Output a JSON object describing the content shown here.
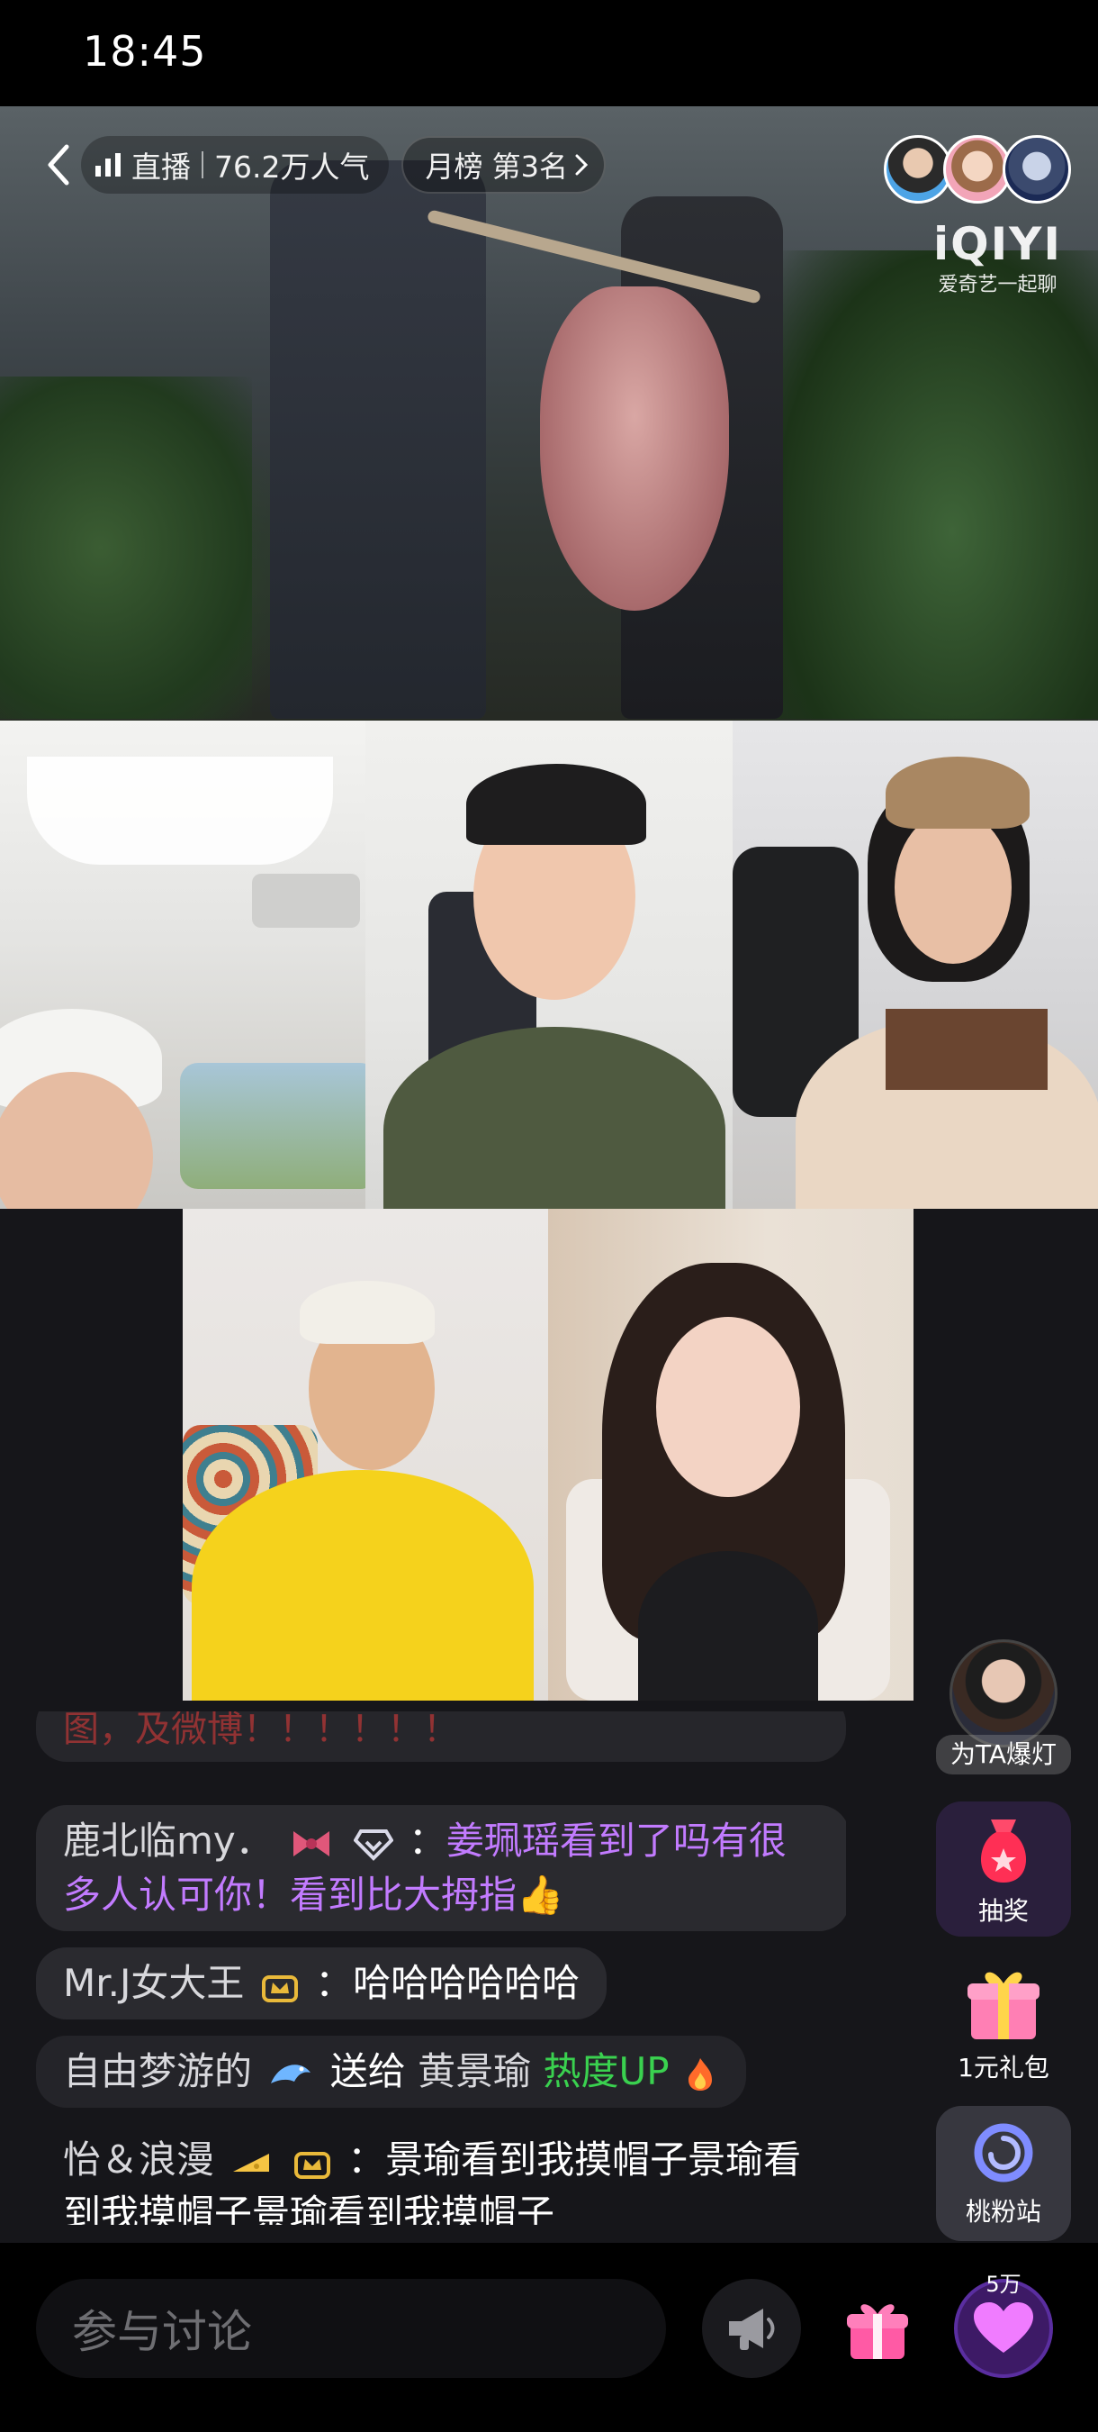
{
  "status_bar": {
    "time": "18:45"
  },
  "live_header": {
    "live_label": "直播",
    "popularity": "76.2万人气",
    "rank_label": "月榜 第3名",
    "brand_logo": "iQIYI",
    "brand_sub": "爱奇艺一起聊"
  },
  "chat": {
    "messages": [
      {
        "user": "",
        "text": "图，及微博！！！！！！"
      },
      {
        "user": "鹿北临my．",
        "text": "姜珮瑶看到了吗有很多人认可你！看到比大拇指👍"
      },
      {
        "user": "Mr.J女大王",
        "text": "哈哈哈哈哈哈"
      },
      {
        "user": "自由梦游的",
        "gift_to_label": "送给",
        "recipient": "黄景瑜",
        "gift_name": "热度UP"
      },
      {
        "user": "怡＆浪漫",
        "text": "景瑜看到我摸帽子景瑜看到我摸帽子景瑜看到我摸帽子"
      }
    ]
  },
  "side_actions": {
    "spotlight_label": "为TA爆灯",
    "lottery_label": "抽奖",
    "gift_pack_label": "1元礼包",
    "fan_station_label": "桃粉站"
  },
  "bottom_bar": {
    "input_placeholder": "参与讨论",
    "like_count": "5万"
  },
  "colors": {
    "chat_highlight": "#c27bff",
    "gift_green": "#3ad14f",
    "like_purple": "#3d1a66"
  },
  "icons": [
    "back-icon",
    "signal-icon",
    "chevron-right-icon",
    "megaphone-icon",
    "gift-icon",
    "heart-icon",
    "lottery-bag-icon",
    "gift-box-icon",
    "fan-station-icon"
  ]
}
